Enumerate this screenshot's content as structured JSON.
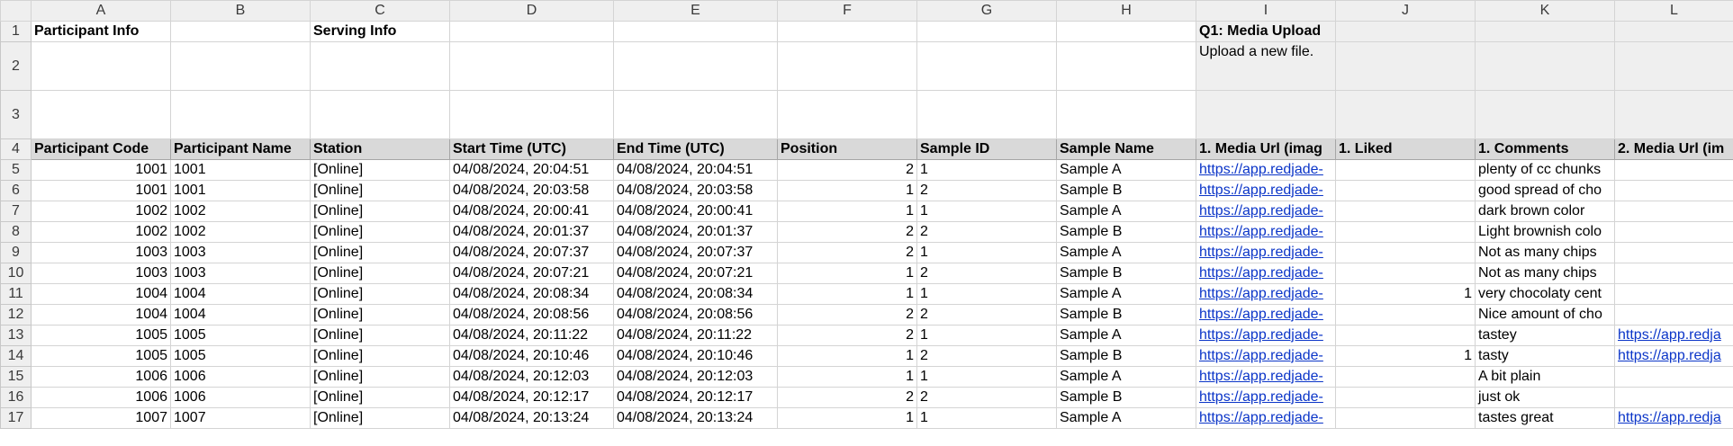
{
  "columns": [
    "A",
    "B",
    "C",
    "D",
    "E",
    "F",
    "G",
    "H",
    "I",
    "J",
    "K",
    "L"
  ],
  "rows": {
    "r1": {
      "n": "1",
      "a": "Participant Info",
      "c": "Serving Info",
      "i": "Q1: Media Upload"
    },
    "r2": {
      "n": "2",
      "i": "Upload a new file."
    },
    "r3": {
      "n": "3"
    },
    "headers": {
      "n": "4",
      "cells": [
        "Participant Code",
        "Participant Name",
        "Station",
        "Start Time (UTC)",
        "End Time (UTC)",
        "Position",
        "Sample ID",
        "Sample Name",
        "1. Media Url (imag",
        "1. Liked",
        "1. Comments",
        "2. Media Url (im"
      ]
    },
    "data": [
      {
        "n": "5",
        "code": "1001",
        "name": "1001",
        "station": "[Online]",
        "start": "04/08/2024, 20:04:51",
        "end": "04/08/2024, 20:04:51",
        "pos": "2",
        "sid": "1",
        "sname": "Sample A",
        "url": "https://app.redjade-",
        "liked": "",
        "comment": "plenty of cc chunks",
        "url2": ""
      },
      {
        "n": "6",
        "code": "1001",
        "name": "1001",
        "station": "[Online]",
        "start": "04/08/2024, 20:03:58",
        "end": "04/08/2024, 20:03:58",
        "pos": "1",
        "sid": "2",
        "sname": "Sample B",
        "url": "https://app.redjade-",
        "liked": "",
        "comment": "good spread of cho",
        "url2": ""
      },
      {
        "n": "7",
        "code": "1002",
        "name": "1002",
        "station": "[Online]",
        "start": "04/08/2024, 20:00:41",
        "end": "04/08/2024, 20:00:41",
        "pos": "1",
        "sid": "1",
        "sname": "Sample A",
        "url": "https://app.redjade-",
        "liked": "",
        "comment": "dark brown color",
        "url2": ""
      },
      {
        "n": "8",
        "code": "1002",
        "name": "1002",
        "station": "[Online]",
        "start": "04/08/2024, 20:01:37",
        "end": "04/08/2024, 20:01:37",
        "pos": "2",
        "sid": "2",
        "sname": "Sample B",
        "url": "https://app.redjade-",
        "liked": "",
        "comment": "Light brownish colo",
        "url2": ""
      },
      {
        "n": "9",
        "code": "1003",
        "name": "1003",
        "station": "[Online]",
        "start": "04/08/2024, 20:07:37",
        "end": "04/08/2024, 20:07:37",
        "pos": "2",
        "sid": "1",
        "sname": "Sample A",
        "url": "https://app.redjade-",
        "liked": "",
        "comment": "Not as many chips",
        "url2": ""
      },
      {
        "n": "10",
        "code": "1003",
        "name": "1003",
        "station": "[Online]",
        "start": "04/08/2024, 20:07:21",
        "end": "04/08/2024, 20:07:21",
        "pos": "1",
        "sid": "2",
        "sname": "Sample B",
        "url": "https://app.redjade-",
        "liked": "",
        "comment": "Not as many chips",
        "url2": ""
      },
      {
        "n": "11",
        "code": "1004",
        "name": "1004",
        "station": "[Online]",
        "start": "04/08/2024, 20:08:34",
        "end": "04/08/2024, 20:08:34",
        "pos": "1",
        "sid": "1",
        "sname": "Sample A",
        "url": "https://app.redjade-",
        "liked": "1",
        "comment": "very chocolaty cent",
        "url2": ""
      },
      {
        "n": "12",
        "code": "1004",
        "name": "1004",
        "station": "[Online]",
        "start": "04/08/2024, 20:08:56",
        "end": "04/08/2024, 20:08:56",
        "pos": "2",
        "sid": "2",
        "sname": "Sample B",
        "url": "https://app.redjade-",
        "liked": "",
        "comment": "Nice amount of cho",
        "url2": ""
      },
      {
        "n": "13",
        "code": "1005",
        "name": "1005",
        "station": "[Online]",
        "start": "04/08/2024, 20:11:22",
        "end": "04/08/2024, 20:11:22",
        "pos": "2",
        "sid": "1",
        "sname": "Sample A",
        "url": "https://app.redjade-",
        "liked": "",
        "comment": "tastey",
        "url2": "https://app.redja"
      },
      {
        "n": "14",
        "code": "1005",
        "name": "1005",
        "station": "[Online]",
        "start": "04/08/2024, 20:10:46",
        "end": "04/08/2024, 20:10:46",
        "pos": "1",
        "sid": "2",
        "sname": "Sample B",
        "url": "https://app.redjade-",
        "liked": "1",
        "comment": "tasty",
        "url2": "https://app.redja"
      },
      {
        "n": "15",
        "code": "1006",
        "name": "1006",
        "station": "[Online]",
        "start": "04/08/2024, 20:12:03",
        "end": "04/08/2024, 20:12:03",
        "pos": "1",
        "sid": "1",
        "sname": "Sample A",
        "url": "https://app.redjade-",
        "liked": "",
        "comment": "A bit plain",
        "url2": ""
      },
      {
        "n": "16",
        "code": "1006",
        "name": "1006",
        "station": "[Online]",
        "start": "04/08/2024, 20:12:17",
        "end": "04/08/2024, 20:12:17",
        "pos": "2",
        "sid": "2",
        "sname": "Sample B",
        "url": "https://app.redjade-",
        "liked": "",
        "comment": "just ok",
        "url2": ""
      },
      {
        "n": "17",
        "code": "1007",
        "name": "1007",
        "station": "[Online]",
        "start": "04/08/2024, 20:13:24",
        "end": "04/08/2024, 20:13:24",
        "pos": "1",
        "sid": "1",
        "sname": "Sample A",
        "url": "https://app.redjade-",
        "liked": "",
        "comment": "tastes great",
        "url2": "https://app.redja"
      }
    ]
  },
  "colors": {
    "header_fill": "#d9d9d9",
    "link": "#0b35c8",
    "gridline": "#d4d4d4",
    "rowcol_header": "#efefef"
  }
}
